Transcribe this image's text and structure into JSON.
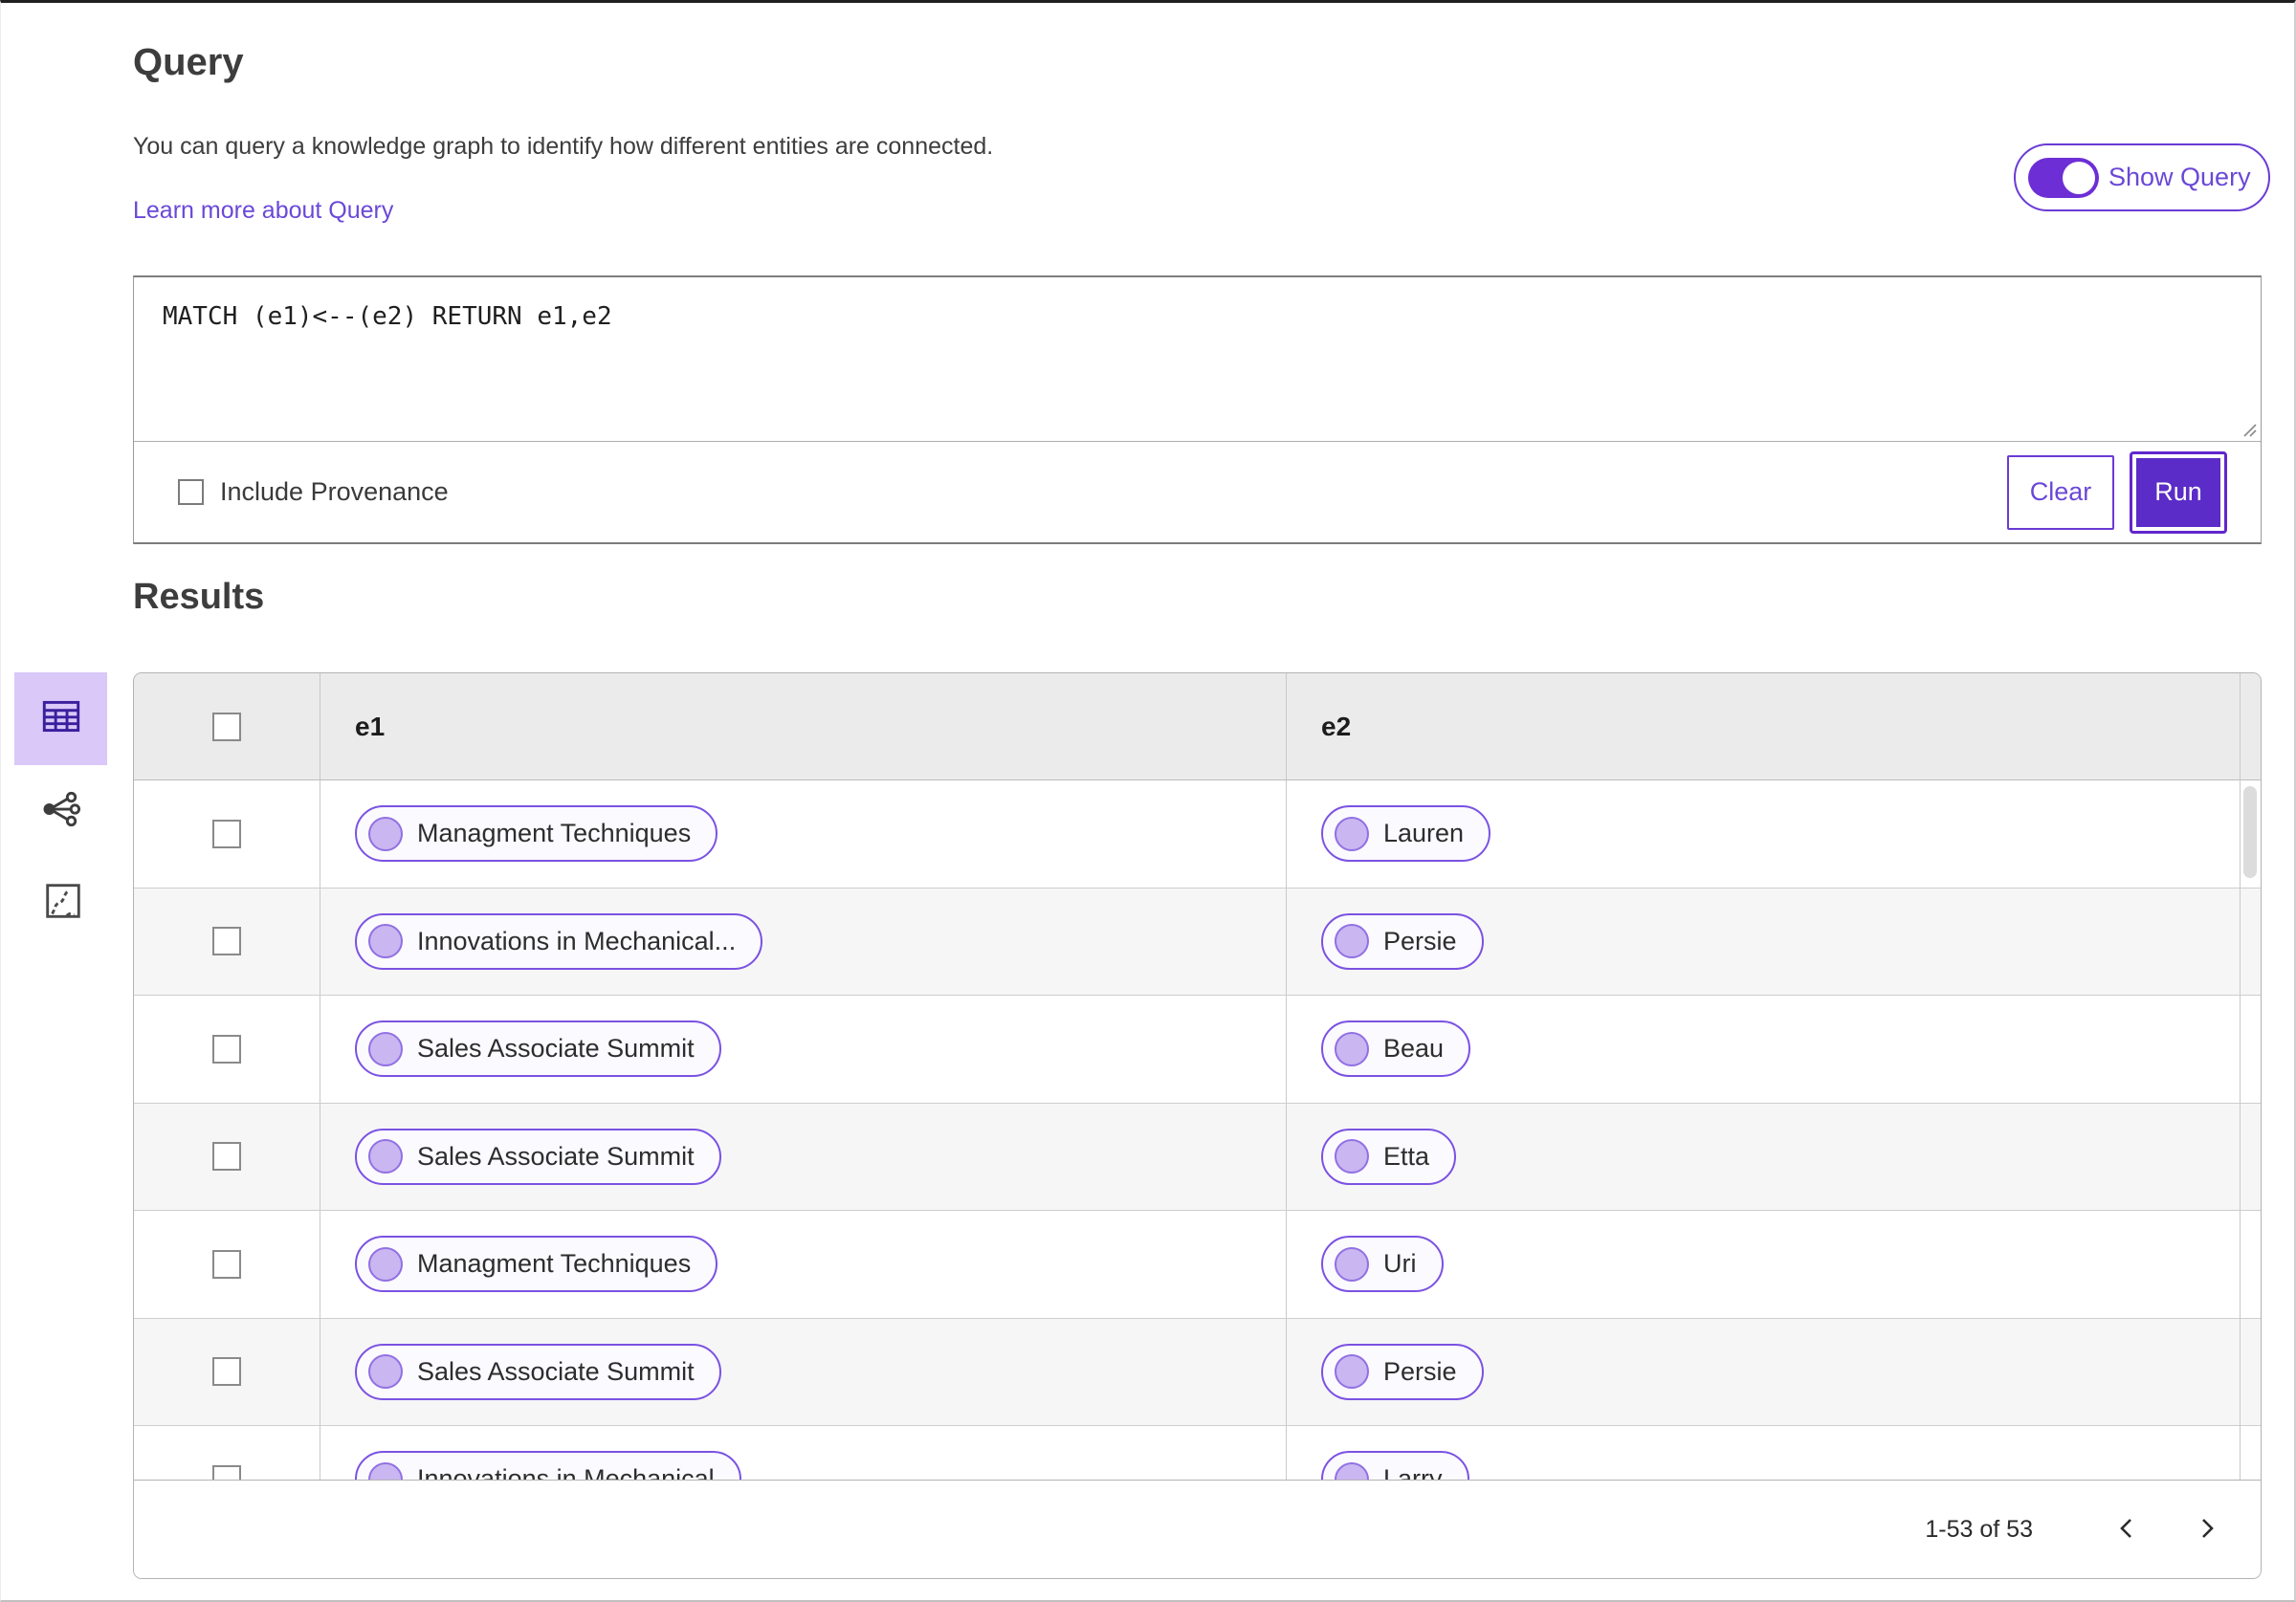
{
  "header": {
    "title": "Query",
    "description": "You can query a knowledge graph to identify how different entities are connected.",
    "learn_more_label": "Learn more about Query",
    "show_query_label": "Show Query",
    "show_query_toggle_state": "on"
  },
  "query_editor": {
    "query_text": "MATCH (e1)<--(e2) RETURN e1,e2",
    "include_provenance_label": "Include Provenance",
    "include_provenance_checked": false,
    "clear_label": "Clear",
    "run_label": "Run"
  },
  "results": {
    "heading": "Results",
    "columns": {
      "e1": "e1",
      "e2": "e2"
    },
    "rows": [
      {
        "e1": "Managment Techniques",
        "e2": "Lauren"
      },
      {
        "e1": "Innovations in Mechanical...",
        "e2": "Persie"
      },
      {
        "e1": "Sales Associate Summit",
        "e2": "Beau"
      },
      {
        "e1": "Sales Associate Summit",
        "e2": "Etta"
      },
      {
        "e1": "Managment Techniques",
        "e2": "Uri"
      },
      {
        "e1": "Sales Associate Summit",
        "e2": "Persie"
      },
      {
        "e1": "Innovations in Mechanical",
        "e2": "Larry"
      }
    ],
    "pagination": {
      "range_label": "1-53 of 53"
    }
  },
  "view_switcher": {
    "selected": "table-view",
    "items": [
      "table-view",
      "network-view",
      "map-view"
    ]
  },
  "icons": {
    "table_view": "table-grid",
    "network_view": "share-network",
    "map_view": "route-map",
    "prev": "chevron-left",
    "next": "chevron-right",
    "resize": "drag-corner"
  },
  "colors": {
    "accent_purple": "#6a3bd4",
    "toggle_fill": "#6d2ed6",
    "run_button_bg": "#5b2cc7",
    "link": "#6a48d7",
    "tile_bg": "#d9c8f8",
    "tile_icon": "#3a1f9e",
    "chip_border": "#7b52e2",
    "chip_bg": "#fbfaff",
    "chip_dot": "#cab6f1",
    "header_row_bg": "#ebebeb",
    "alt_row_bg": "#f6f6f6"
  }
}
